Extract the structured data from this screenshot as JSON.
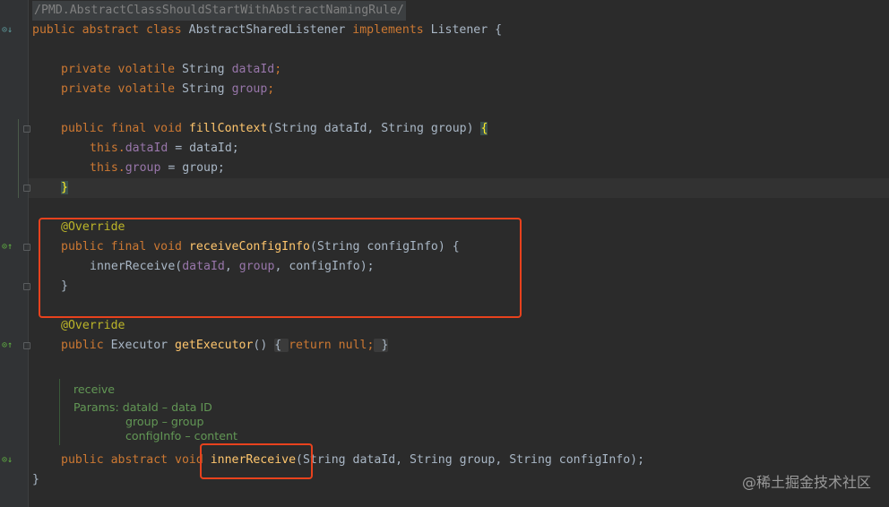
{
  "editor": {
    "comment": "/PMD.AbstractClassShouldStartWithAbstractNamingRule/",
    "lines": {
      "l1": {
        "kw": "public abstract class ",
        "cls": "AbstractSharedListener ",
        "kw2": "implements ",
        "rest": "Listener {"
      },
      "l2": {
        "kw": "private volatile ",
        "type": "String ",
        "field": "dataId",
        "end": ";"
      },
      "l3": {
        "kw": "private volatile ",
        "type": "String ",
        "field": "group",
        "end": ";"
      },
      "l4": {
        "kw": "public final void ",
        "fn": "fillContext",
        "params": "(String dataId, String group) ",
        "brace": "{"
      },
      "l5": {
        "kw": "this.",
        "field": "dataId",
        "rest": " = dataId;"
      },
      "l6": {
        "kw": "this.",
        "field": "group",
        "rest": " = group;"
      },
      "l7": {
        "brace": "}"
      },
      "l8": {
        "ann": "@Override"
      },
      "l9": {
        "kw": "public final void ",
        "fn": "receiveConfigInfo",
        "params": "(String configInfo) {"
      },
      "l10": {
        "call": "innerReceive(",
        "f1": "dataId",
        "sep1": ", ",
        "f2": "group",
        "rest": ", configInfo);"
      },
      "l11": {
        "brace": "}"
      },
      "l12": {
        "ann": "@Override"
      },
      "l13": {
        "kw": "public ",
        "type": "Executor ",
        "fn": "getExecutor",
        "paren": "() ",
        "fold_open": "{ ",
        "kw_ret": "return null",
        "semi": ";",
        "fold_close": " }"
      },
      "l14": {
        "kw": "public abstract void ",
        "fn": "innerReceive",
        "params": "(String dataId, String group, String configInfo);"
      },
      "l15": {
        "brace": "}"
      }
    },
    "javadoc": {
      "title": "receive",
      "params_label": "Params: ",
      "p1": "dataId – data ID",
      "p2": "group – group",
      "p3": "configInfo – content"
    }
  },
  "watermark": "@稀土掘金技术社区",
  "colors": {
    "background": "#2b2b2b",
    "keyword": "#cc7832",
    "function": "#ffc66d",
    "field": "#9876aa",
    "annotation": "#bbb529",
    "doc": "#629755",
    "highlight_box": "#e8421d"
  }
}
